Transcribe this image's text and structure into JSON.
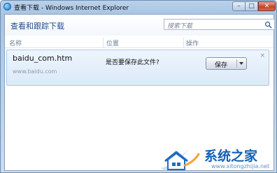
{
  "window": {
    "title": "查看下载 - Windows Internet Explorer",
    "minimize_symbol": "–",
    "maximize_symbol": "□",
    "close_symbol": "✕"
  },
  "page": {
    "title": "查看和跟踪下载"
  },
  "search": {
    "placeholder": "搜索下载",
    "icon": "search-icon"
  },
  "columns": [
    "名称",
    "位置",
    "操作"
  ],
  "downloads": [
    {
      "file_name": "baidu_com.htm",
      "source": "www.baidu.com",
      "prompt": "是否要保存此文件?",
      "save_label": "保存",
      "close_symbol": "×"
    }
  ],
  "watermark": {
    "title": "系统之家",
    "url": "www.xitongzhijia.net"
  },
  "colors": {
    "title_accent": "#1e4b8c",
    "row_highlight": "#dce9f8",
    "watermark_blue": "#1460b4"
  }
}
